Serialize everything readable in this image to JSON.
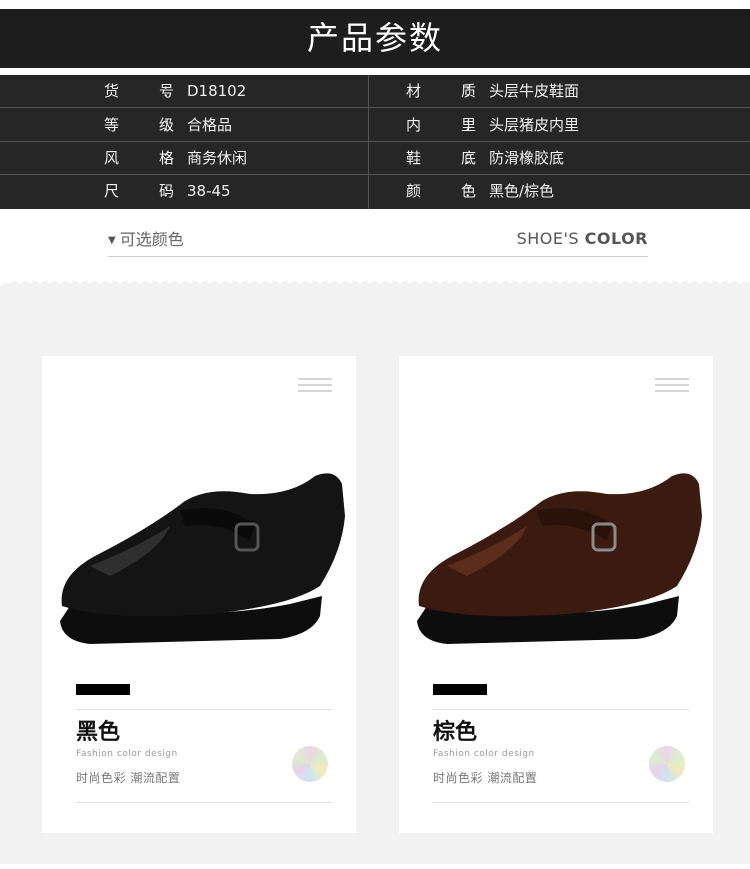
{
  "title": "产品参数",
  "params": [
    [
      {
        "label": "货号",
        "value": "D18102"
      },
      {
        "label": "材质",
        "value": "头层牛皮鞋面"
      }
    ],
    [
      {
        "label": "等级",
        "value": "合格品"
      },
      {
        "label": "内里",
        "value": "头层猪皮内里"
      }
    ],
    [
      {
        "label": "风格",
        "value": "商务休闲"
      },
      {
        "label": "鞋底",
        "value": "防滑橡胶底"
      }
    ],
    [
      {
        "label": "尺码",
        "value": "38-45"
      },
      {
        "label": "颜色",
        "value": "黑色/棕色"
      }
    ]
  ],
  "colon": "：",
  "color_section": {
    "left_label": "可选颜色",
    "right_prefix": "SHOE'S",
    "right_bold": "COLOR"
  },
  "cards": [
    {
      "name": "黑色",
      "en": "Fashion color design",
      "cn": "时尚色彩  潮流配置",
      "shoe_color": "#141414",
      "shoe_light": "#3a3a3a"
    },
    {
      "name": "棕色",
      "en": "Fashion color design",
      "cn": "时尚色彩  潮流配置",
      "shoe_color": "#3b1a10",
      "shoe_light": "#6b3626"
    }
  ],
  "colors": {
    "title_bg": "#1d1d1d",
    "table_bg": "#262626",
    "panel_bg": "#f2f2f2"
  }
}
